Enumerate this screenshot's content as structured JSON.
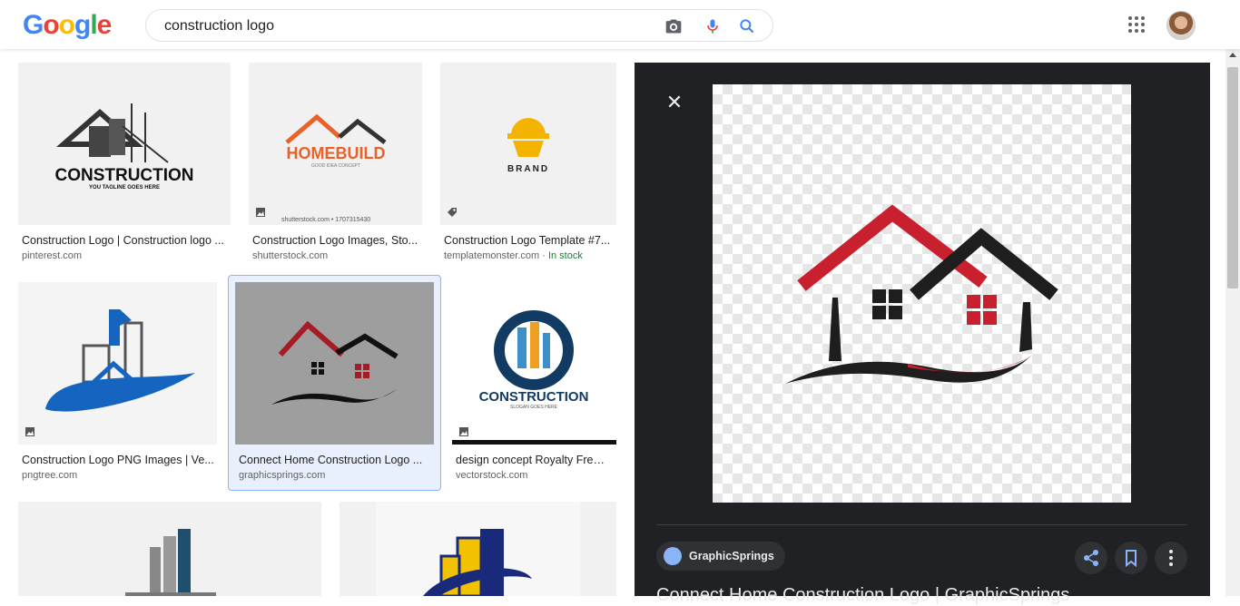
{
  "header": {
    "logo_letters": [
      {
        "ch": "G",
        "color": "#4285F4"
      },
      {
        "ch": "o",
        "color": "#EA4335"
      },
      {
        "ch": "o",
        "color": "#FBBC05"
      },
      {
        "ch": "g",
        "color": "#4285F4"
      },
      {
        "ch": "l",
        "color": "#34A853"
      },
      {
        "ch": "e",
        "color": "#EA4335"
      }
    ],
    "search_query": "construction logo",
    "icons": [
      "camera-icon",
      "microphone-icon",
      "search-icon",
      "apps-grid-icon",
      "avatar"
    ]
  },
  "results": [
    {
      "title": "Construction Logo | Construction logo ...",
      "source": "pinterest.com",
      "badge": "",
      "in_stock": ""
    },
    {
      "title": "Construction Logo Images, Sto...",
      "source": "shutterstock.com",
      "badge": "image-icon",
      "in_stock": ""
    },
    {
      "title": "Construction Logo Template #7...",
      "source": "templatemonster.com",
      "badge": "tag-icon",
      "in_stock": "In stock"
    },
    {
      "title": "Construction Logo PNG Images | Ve...",
      "source": "pngtree.com",
      "badge": "image-icon",
      "in_stock": ""
    },
    {
      "title": "Connect Home Construction Logo ...",
      "source": "graphicsprings.com",
      "badge": "",
      "in_stock": ""
    },
    {
      "title": "design concept Royalty Free ...",
      "source": "vectorstock.com",
      "badge": "image-icon",
      "in_stock": ""
    }
  ],
  "thumb_text": {
    "r1": "CONSTRUCTION",
    "r1_tag": "YOU TAGLINE GOES HERE",
    "r2": "HOMEBUILD",
    "r2_tag": "GOOD IDEA CONCEPT",
    "r2_watermark": "shutterstock.com • 1707315430",
    "r3": "BRAND",
    "r6": "CONSTRUCTION",
    "r6_tag": "SLOGAN GOES HERE"
  },
  "panel": {
    "source_name": "GraphicSprings",
    "title": "Connect Home Construction Logo | GraphicSprings"
  },
  "colors": {
    "accent_blue": "#1a73e8",
    "panel_bg": "#202124",
    "logo_red": "#c8202e",
    "logo_dark": "#222222",
    "selected_border": "#8ab4f8"
  }
}
